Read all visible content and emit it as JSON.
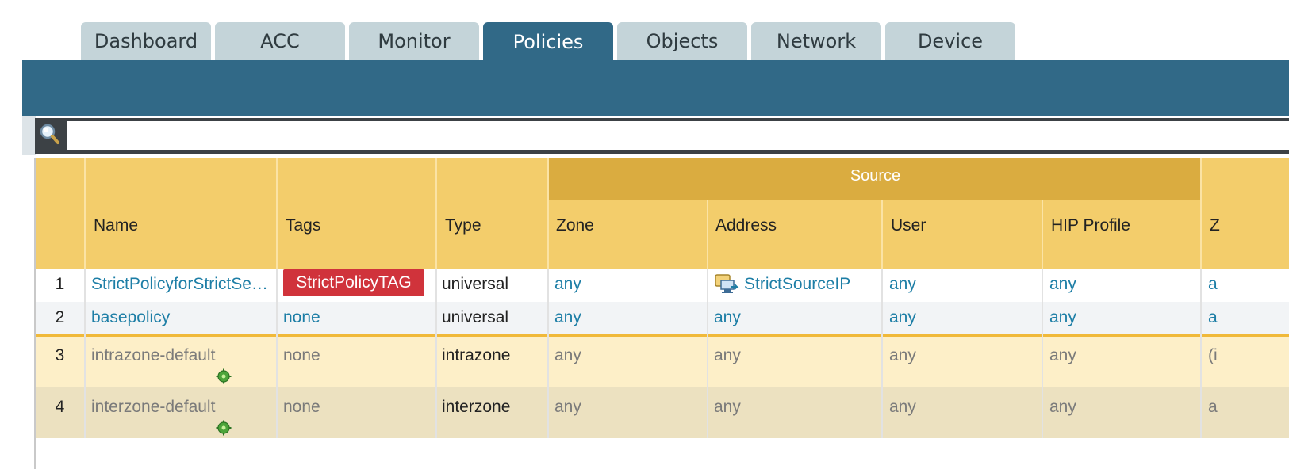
{
  "tabs": [
    {
      "label": "Dashboard"
    },
    {
      "label": "ACC"
    },
    {
      "label": "Monitor"
    },
    {
      "label": "Policies"
    },
    {
      "label": "Objects"
    },
    {
      "label": "Network"
    },
    {
      "label": "Device"
    }
  ],
  "active_tab": "Policies",
  "search": {
    "placeholder": "",
    "value": ""
  },
  "table": {
    "group_header": "Source",
    "columns": [
      "",
      "Name",
      "Tags",
      "Type",
      "Zone",
      "Address",
      "User",
      "HIP Profile",
      "Z"
    ],
    "rows": [
      {
        "num": "1",
        "name": "StrictPolicyforStrictSe…",
        "tags": "StrictPolicyTAG",
        "type": "universal",
        "zone": "any",
        "address": "StrictSourceIP",
        "user": "any",
        "hip": "any",
        "dest": "a"
      },
      {
        "num": "2",
        "name": "basepolicy",
        "tags": "none",
        "type": "universal",
        "zone": "any",
        "address": "any",
        "user": "any",
        "hip": "any",
        "dest": "a"
      },
      {
        "num": "3",
        "name": "intrazone-default",
        "tags": "none",
        "type": "intrazone",
        "zone": "any",
        "address": "any",
        "user": "any",
        "hip": "any",
        "dest": "(i"
      },
      {
        "num": "4",
        "name": "interzone-default",
        "tags": "none",
        "type": "interzone",
        "zone": "any",
        "address": "any",
        "user": "any",
        "hip": "any",
        "dest": "a"
      }
    ]
  },
  "colors": {
    "tab_active": "#316987",
    "tab_inactive": "#c4d4d9",
    "header_yellow": "#f3cd6b",
    "group_header": "#daac40",
    "tag_red": "#d0333b",
    "link_blue": "#1d7ea6",
    "default_row_1": "#fdefc8",
    "default_row_2": "#ece1c0"
  },
  "icons": {
    "search": "search-icon",
    "address": "address-object-icon",
    "override": "gear-icon"
  }
}
